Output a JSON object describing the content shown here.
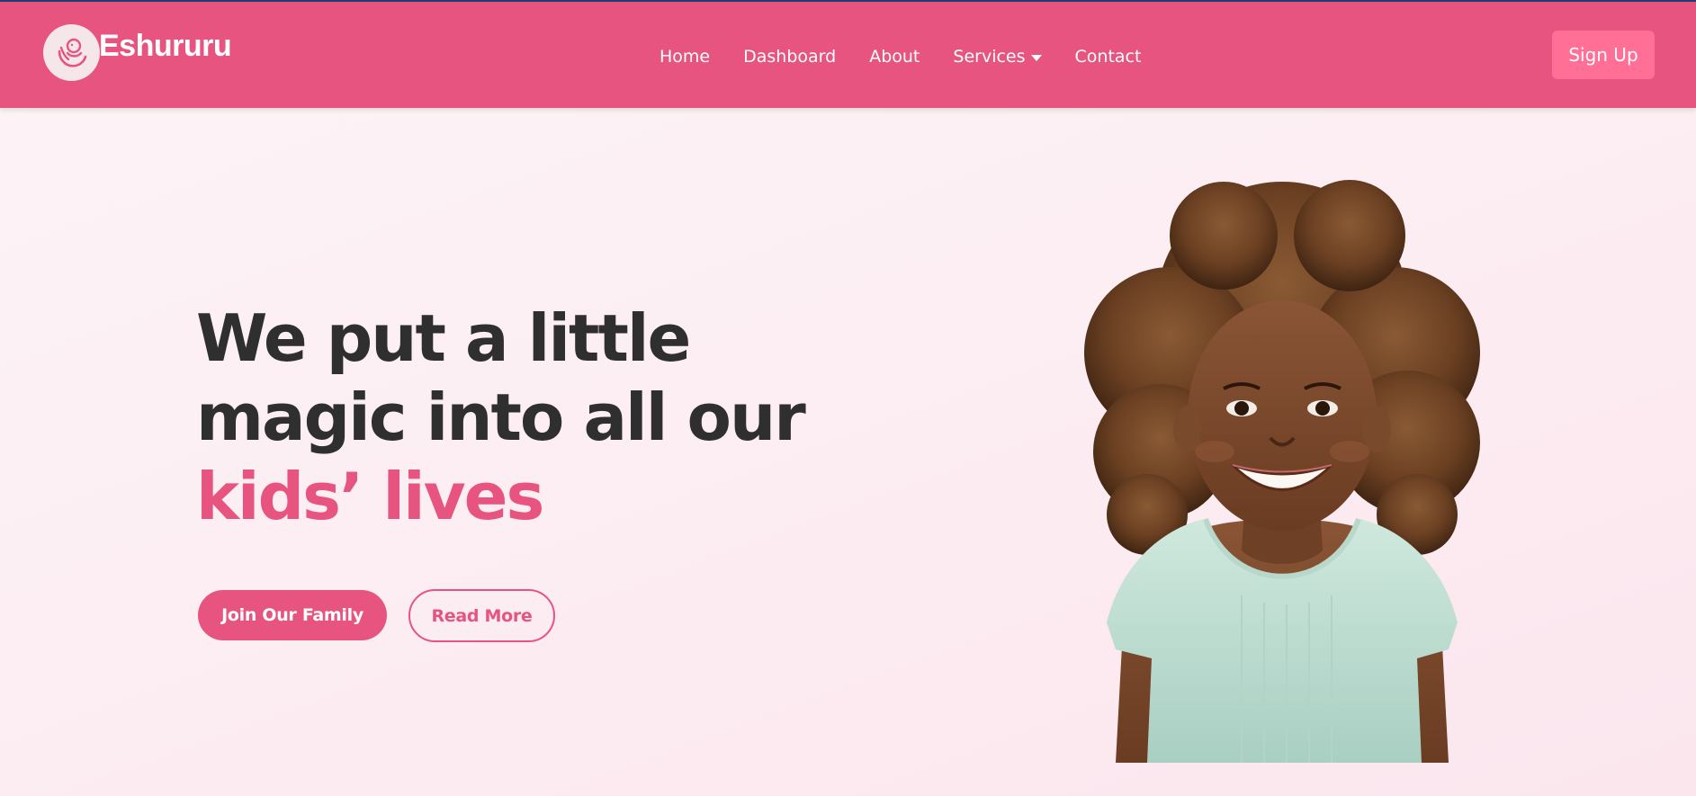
{
  "brand": {
    "name": "Eshururu",
    "logo_icon": "baby-in-hands-icon"
  },
  "nav": {
    "items": [
      {
        "label": "Home"
      },
      {
        "label": "Dashboard"
      },
      {
        "label": "About"
      },
      {
        "label": "Services",
        "has_dropdown": true
      },
      {
        "label": "Contact"
      }
    ],
    "signup_label": "Sign Up"
  },
  "hero": {
    "headline_line1": "We put a little",
    "headline_line2": "magic into all our",
    "headline_accent": "kids’ lives",
    "primary_button": "Join Our Family",
    "secondary_button": "Read More",
    "image_alt": "smiling child with curly hair"
  },
  "colors": {
    "accent": "#e75480",
    "signup": "#ff6f96",
    "text_dark": "#2f2f2f",
    "background": "#fdf4f7"
  }
}
